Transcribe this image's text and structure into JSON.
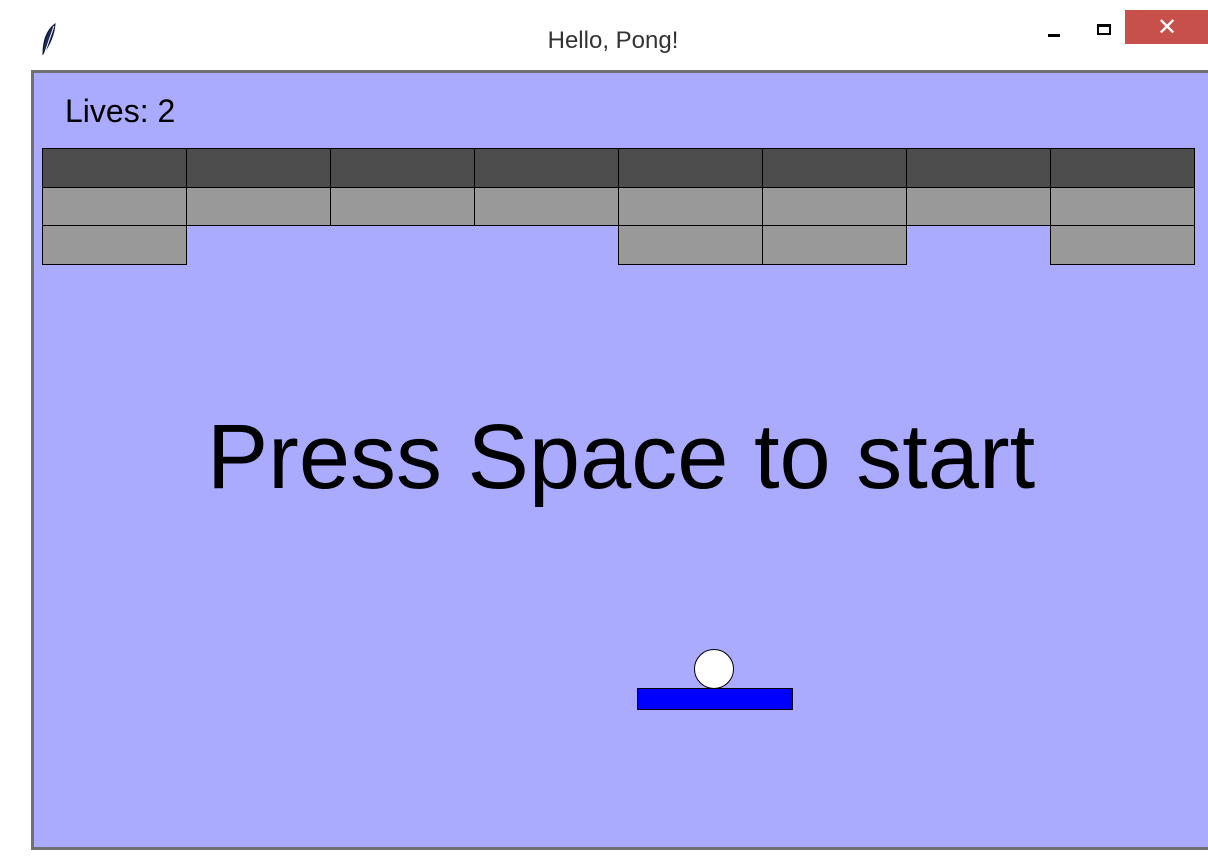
{
  "window": {
    "title": "Hello, Pong!",
    "minimize_glyph": "",
    "close_glyph": "✕",
    "icon": "feather-icon"
  },
  "game": {
    "lives_label": "Lives: 2",
    "start_message": "Press Space to start",
    "background_color": "#aaaaff",
    "ball_color": "#ffffff",
    "paddle_color": "#0000ff",
    "brick_colors": {
      "strong": "#4d4d4d",
      "weak": "#999999"
    },
    "bricks": [
      [
        "strong",
        "strong",
        "strong",
        "strong",
        "strong",
        "strong",
        "strong",
        "strong"
      ],
      [
        "weak",
        "weak",
        "weak",
        "weak",
        "weak",
        "weak",
        "weak",
        "weak"
      ],
      [
        "weak",
        null,
        null,
        null,
        "weak",
        "weak",
        null,
        "weak"
      ]
    ]
  }
}
